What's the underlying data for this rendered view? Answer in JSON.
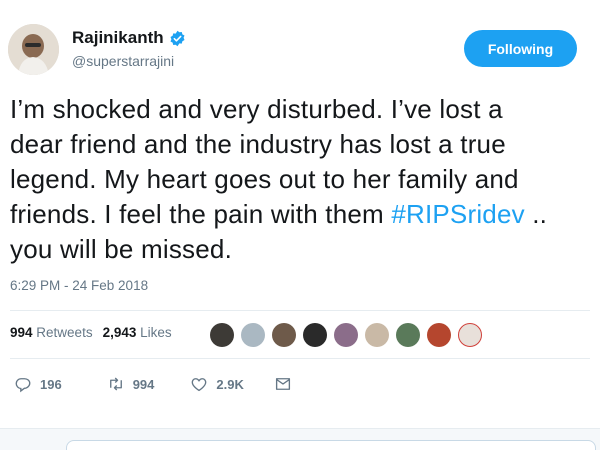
{
  "user": {
    "name": "Rajinikanth",
    "handle": "@superstarrajini",
    "follow_label": "Following"
  },
  "tweet": {
    "lines": [
      "I’m shocked and very disturbed. I’ve lost a",
      "dear friend and the industry has lost a true",
      "legend. My heart goes out to her family and"
    ],
    "line4_prefix": "friends. I feel the pain with them ",
    "hashtag": "#RIPSridev",
    "line4_suffix": " ..",
    "line5": "you will be missed.",
    "timestamp": "6:29 PM - 24 Feb 2018"
  },
  "stats": {
    "retweets_count": "994",
    "retweets_label": "Retweets",
    "likes_count": "2,943",
    "likes_label": "Likes"
  },
  "actions": {
    "reply_count": "196",
    "retweet_count": "994",
    "like_count": "2.9K"
  },
  "icons": [
    "verified-icon",
    "reply-icon",
    "retweet-icon",
    "like-icon",
    "message-icon"
  ],
  "colors": {
    "accent": "#1da1f2",
    "secondary_text": "#657786",
    "primary_text": "#14171a"
  }
}
